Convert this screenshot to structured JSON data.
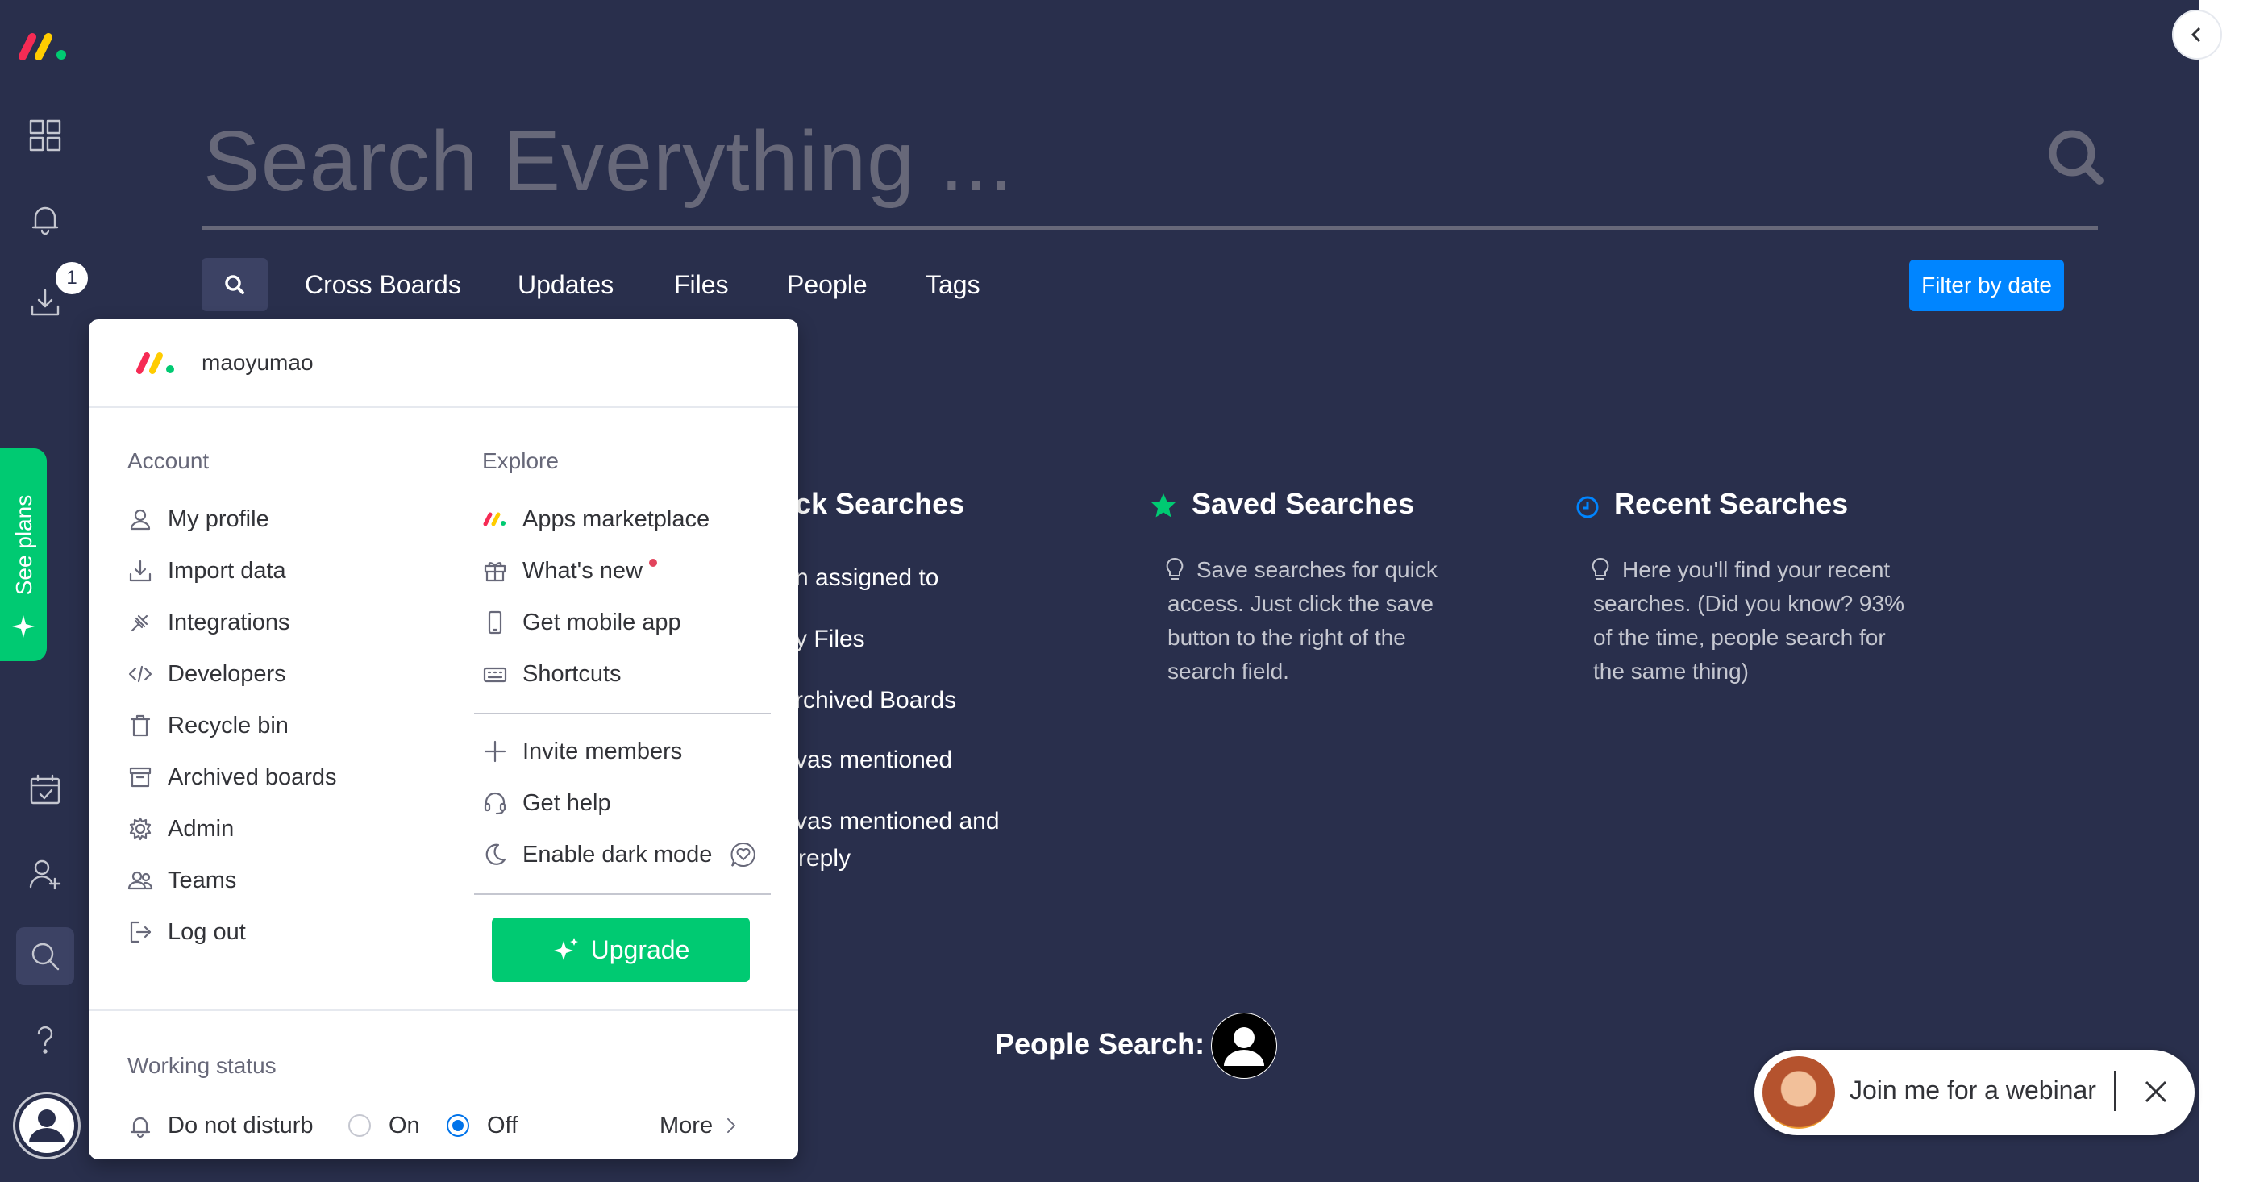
{
  "search": {
    "placeholder": "Search Everything ...",
    "tabs": [
      "Cross Boards",
      "Updates",
      "Files",
      "People",
      "Tags"
    ],
    "filter_button": "Filter by date"
  },
  "sidebar": {
    "notification_badge": "1",
    "see_plans": "See plans"
  },
  "columns": {
    "quick": {
      "title_partial": "ck Searches",
      "items": [
        "n assigned to",
        "y Files",
        "rchived Boards",
        "vas mentioned",
        "vas mentioned and",
        "reply"
      ]
    },
    "saved": {
      "title": "Saved Searches",
      "desc": [
        "Save searches for quick",
        "access. Just click the save",
        "button to the right of the",
        "search field."
      ]
    },
    "recent": {
      "title": "Recent Searches",
      "desc": [
        "Here you'll find your recent",
        "searches. (Did you know? 93%",
        "of the time, people search for",
        "the same thing)"
      ]
    },
    "people_search": "People Search:"
  },
  "menu": {
    "user": "maoyumao",
    "account_title": "Account",
    "account_items": [
      "My profile",
      "Import data",
      "Integrations",
      "Developers",
      "Recycle bin",
      "Archived boards",
      "Admin",
      "Teams",
      "Log out"
    ],
    "explore_title": "Explore",
    "explore_items": [
      "Apps marketplace",
      "What's new",
      "Get mobile app",
      "Shortcuts"
    ],
    "extra_items": [
      "Invite members",
      "Get help",
      "Enable dark mode"
    ],
    "upgrade": "Upgrade",
    "working_status_title": "Working status",
    "do_not_disturb": "Do not disturb",
    "on_label": "On",
    "off_label": "Off",
    "more": "More",
    "selected_status": "Off"
  },
  "webinar": {
    "text": "Join me for a webinar"
  },
  "colors": {
    "background": "#292f4c",
    "accent": "#0085ff",
    "green": "#00ca72",
    "notification_dot": "#e2445c"
  }
}
